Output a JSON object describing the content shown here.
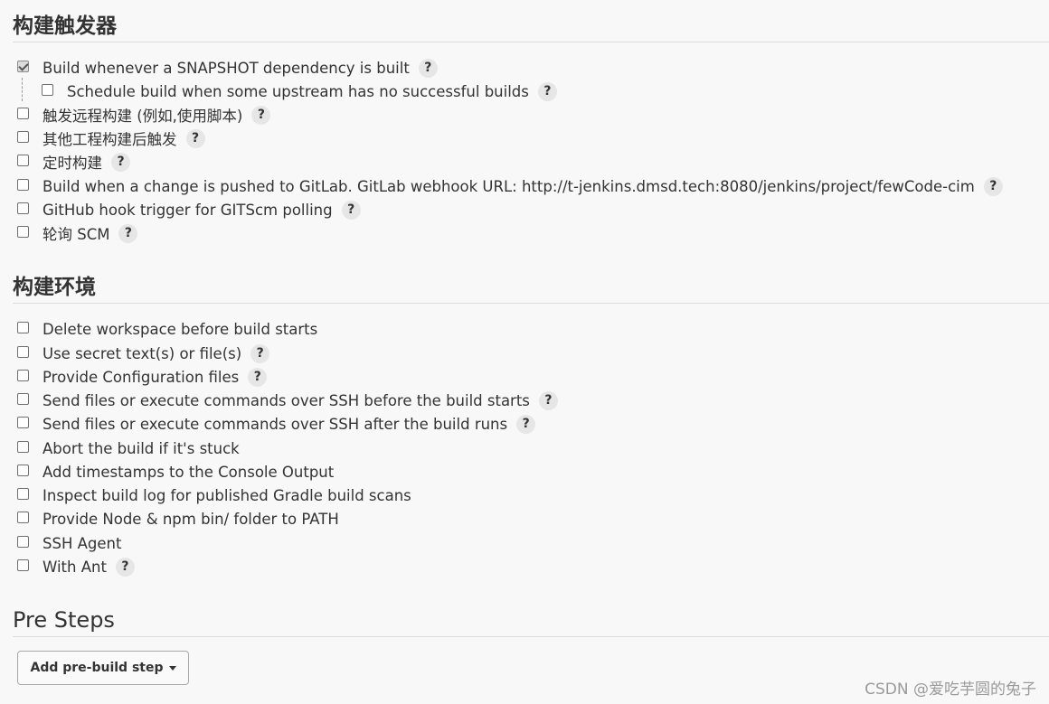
{
  "build_triggers": {
    "title": "构建触发器",
    "options": [
      {
        "label": "Build whenever a SNAPSHOT dependency is built",
        "checked": true,
        "help": "?"
      },
      {
        "label": "Schedule build when some upstream has no successful builds",
        "checked": false,
        "help": "?"
      },
      {
        "label": "触发远程构建 (例如,使用脚本)",
        "checked": false,
        "help": "?"
      },
      {
        "label": "其他工程构建后触发",
        "checked": false,
        "help": "?"
      },
      {
        "label": "定时构建",
        "checked": false,
        "help": "?"
      },
      {
        "label": "Build when a change is pushed to GitLab. GitLab webhook URL: http://t-jenkins.dmsd.tech:8080/jenkins/project/fewCode-cim",
        "checked": false,
        "help": "?"
      },
      {
        "label": "GitHub hook trigger for GITScm polling",
        "checked": false,
        "help": "?"
      },
      {
        "label": "轮询 SCM",
        "checked": false,
        "help": "?"
      }
    ]
  },
  "build_environment": {
    "title": "构建环境",
    "options": [
      {
        "label": "Delete workspace before build starts",
        "checked": false
      },
      {
        "label": "Use secret text(s) or file(s)",
        "checked": false,
        "help": "?"
      },
      {
        "label": "Provide Configuration files",
        "checked": false,
        "help": "?"
      },
      {
        "label": "Send files or execute commands over SSH before the build starts",
        "checked": false,
        "help": "?"
      },
      {
        "label": "Send files or execute commands over SSH after the build runs",
        "checked": false,
        "help": "?"
      },
      {
        "label": "Abort the build if it's stuck",
        "checked": false
      },
      {
        "label": "Add timestamps to the Console Output",
        "checked": false
      },
      {
        "label": "Inspect build log for published Gradle build scans",
        "checked": false
      },
      {
        "label": "Provide Node & npm bin/ folder to PATH",
        "checked": false
      },
      {
        "label": "SSH Agent",
        "checked": false
      },
      {
        "label": "With Ant",
        "checked": false,
        "help": "?"
      }
    ]
  },
  "pre_steps": {
    "title": "Pre Steps",
    "add_button": "Add pre-build step"
  },
  "watermark": "CSDN @爱吃芋圆的兔子"
}
